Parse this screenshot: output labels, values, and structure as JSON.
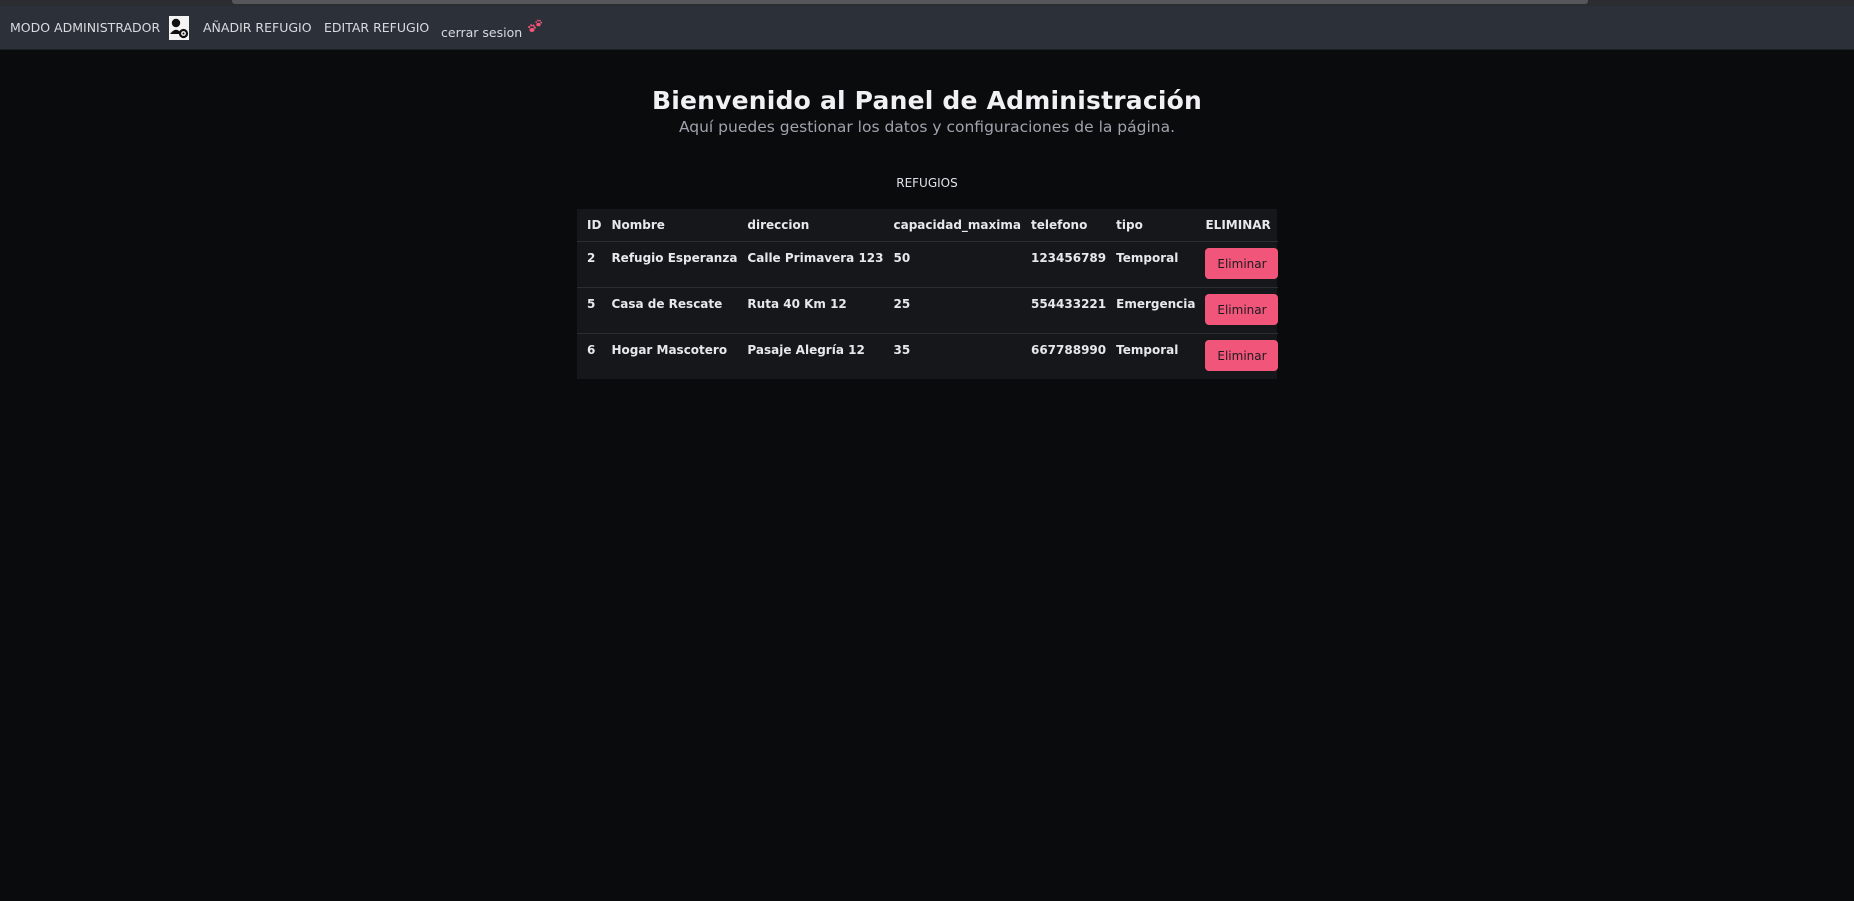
{
  "nav": {
    "admin_label": "MODO ADMINISTRADOR",
    "add_label": "AÑADIR REFUGIO",
    "edit_label": "EDITAR REFUGIO",
    "logout_label": "cerrar sesion",
    "admin_icon": "admin-user-icon",
    "logout_icon": "paw-icon",
    "paw_color": "#f2557a"
  },
  "header": {
    "title": "Bienvenido al Panel de Administración",
    "subtitle": "Aquí puedes gestionar los datos y configuraciones de la página."
  },
  "section": {
    "label": "REFUGIOS"
  },
  "table": {
    "columns": [
      "ID",
      "Nombre",
      "direccion",
      "capacidad_maxima",
      "telefono",
      "tipo",
      "ELIMINAR"
    ],
    "rows": [
      {
        "id": "2",
        "nombre": "Refugio Esperanza",
        "direccion": "Calle Primavera 123",
        "capacidad": "50",
        "telefono": "123456789",
        "tipo": "Temporal",
        "action": "Eliminar"
      },
      {
        "id": "5",
        "nombre": "Casa de Rescate",
        "direccion": "Ruta 40 Km 12",
        "capacidad": "25",
        "telefono": "554433221",
        "tipo": "Emergencia",
        "action": "Eliminar"
      },
      {
        "id": "6",
        "nombre": "Hogar Mascotero",
        "direccion": "Pasaje Alegría 12",
        "capacidad": "35",
        "telefono": "667788990",
        "tipo": "Temporal",
        "action": "Eliminar"
      }
    ]
  },
  "colors": {
    "background": "#0a0b0d",
    "navbar": "#2c3038",
    "table_bg": "#15171b",
    "button": "#f2557a"
  }
}
